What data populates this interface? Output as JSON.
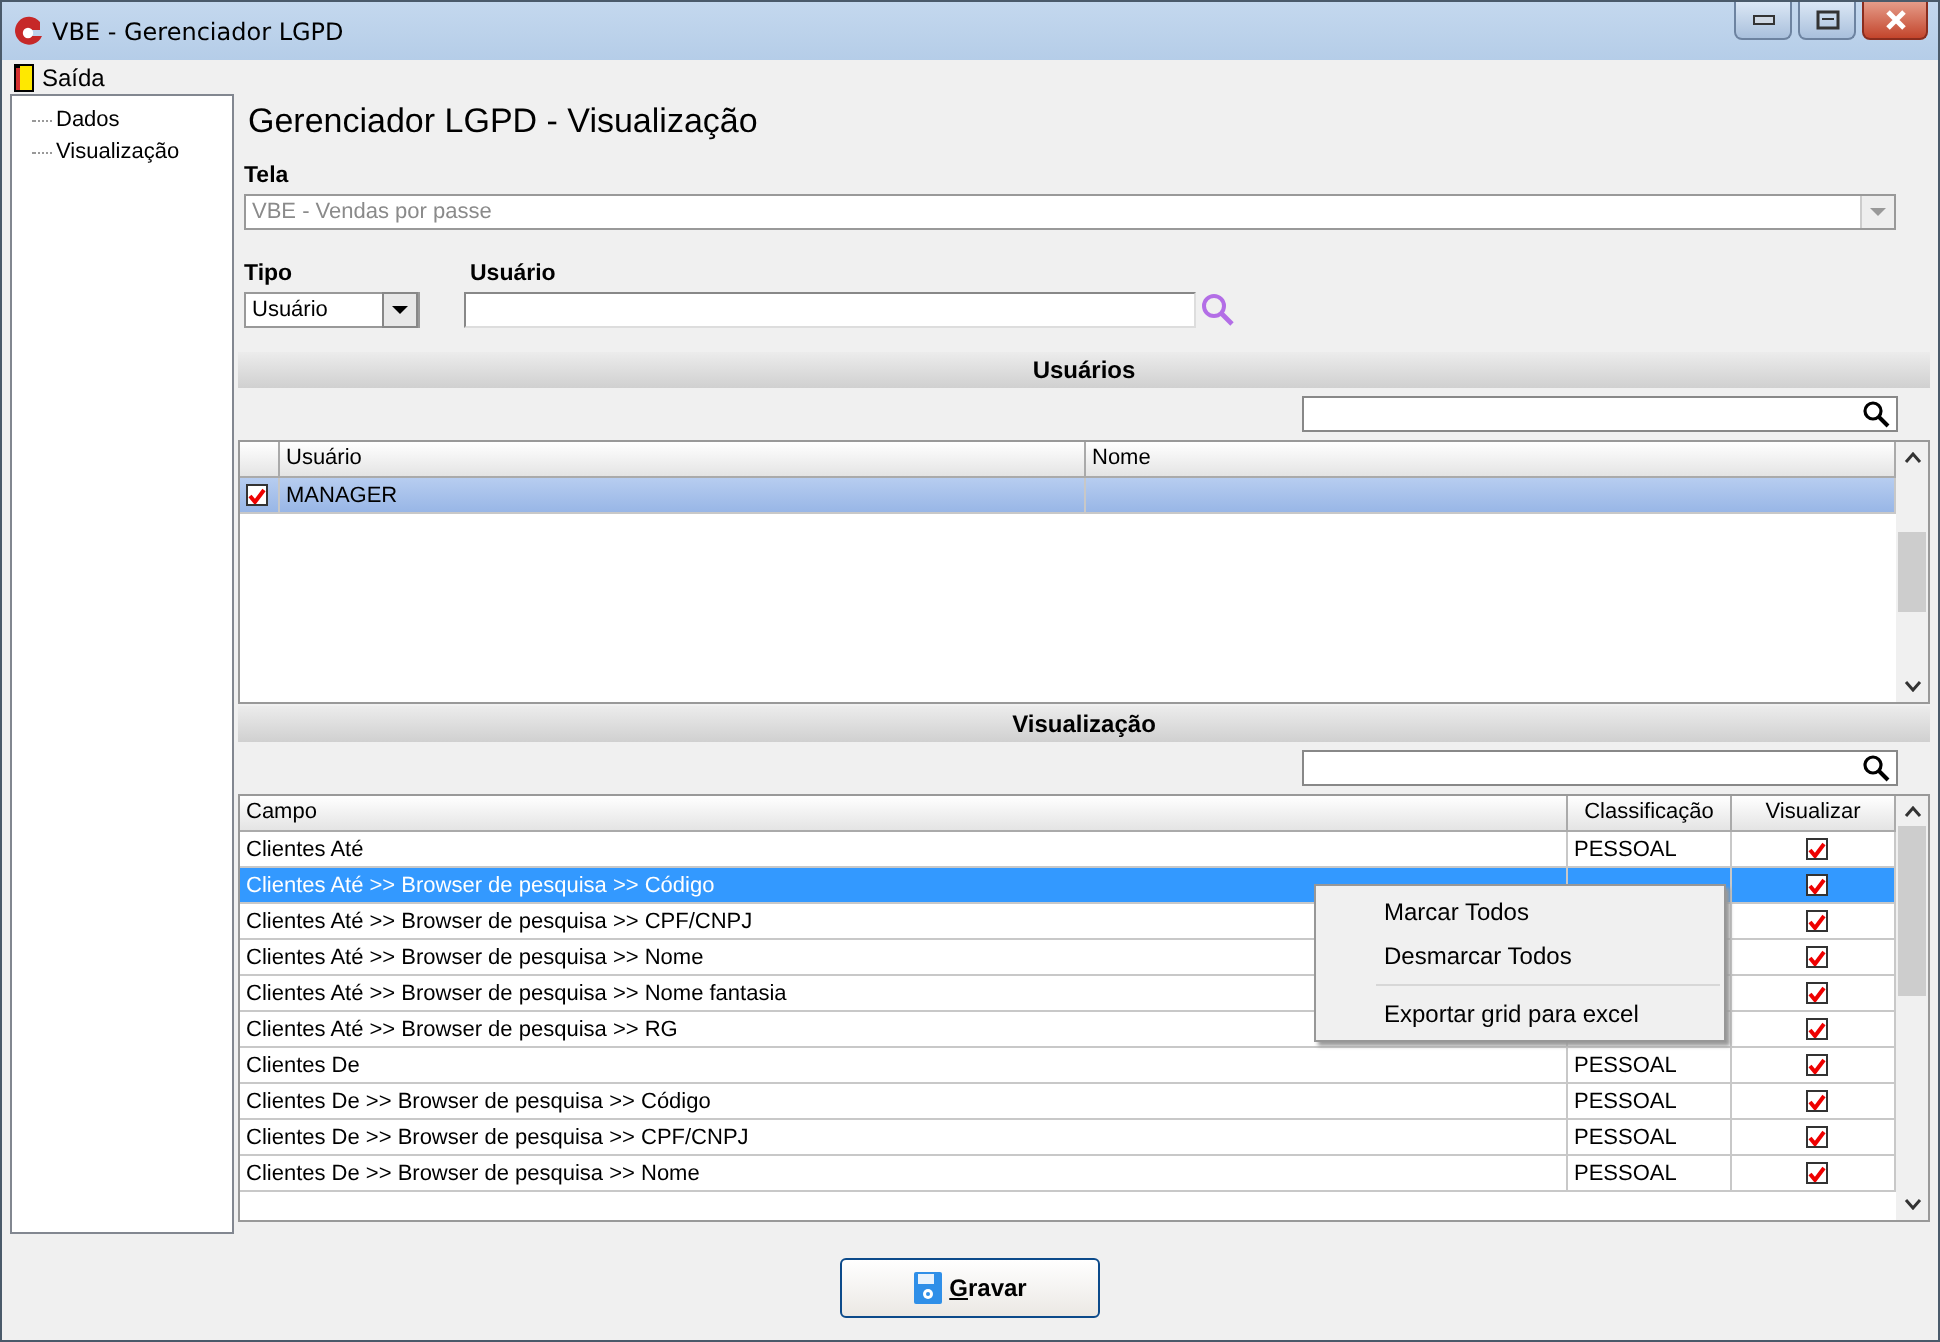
{
  "window": {
    "title": "VBE - Gerenciador LGPD"
  },
  "menu": [
    {
      "label": "Saída"
    }
  ],
  "sidebar": {
    "items": [
      {
        "label": "Dados"
      },
      {
        "label": "Visualização"
      }
    ]
  },
  "page_title": "Gerenciador LGPD - Visualização",
  "tela": {
    "label": "Tela",
    "value": "VBE - Vendas por passe",
    "disabled": true
  },
  "tipo": {
    "label": "Tipo",
    "value": "Usuário"
  },
  "usuario": {
    "label": "Usuário"
  },
  "users_section": {
    "title": "Usuários",
    "columns": [
      "Usuário",
      "Nome"
    ],
    "rows": [
      {
        "usuario": "MANAGER",
        "checked": true,
        "selected": true
      }
    ]
  },
  "view_section": {
    "title": "Visualização",
    "columns": [
      "Campo",
      "Classificação",
      "Visualizar"
    ],
    "rows": [
      {
        "campo": "Clientes Até",
        "classificacao": "PESSOAL",
        "visualizar": true,
        "selected": false
      },
      {
        "campo": "Clientes Até >> Browser de pesquisa >> Código",
        "visualizar": true,
        "selected": true
      },
      {
        "campo": "Clientes Até >> Browser de pesquisa >> CPF/CNPJ",
        "visualizar": true,
        "selected": false
      },
      {
        "campo": "Clientes Até >> Browser de pesquisa >> Nome",
        "visualizar": true,
        "selected": false
      },
      {
        "campo": "Clientes Até >> Browser de pesquisa >> Nome fantasia",
        "visualizar": true,
        "selected": false
      },
      {
        "campo": "Clientes Até >> Browser de pesquisa >> RG",
        "visualizar": true,
        "selected": false
      },
      {
        "campo": "Clientes De",
        "classificacao": "PESSOAL",
        "visualizar": true,
        "selected": false
      },
      {
        "campo": "Clientes De >> Browser de pesquisa >> Código",
        "classificacao": "PESSOAL",
        "visualizar": true,
        "selected": false
      },
      {
        "campo": "Clientes De >> Browser de pesquisa >> CPF/CNPJ",
        "classificacao": "PESSOAL",
        "visualizar": true,
        "selected": false
      },
      {
        "campo": "Clientes De >> Browser de pesquisa >> Nome",
        "classificacao": "PESSOAL",
        "visualizar": true,
        "selected": false
      }
    ]
  },
  "context_menu": {
    "items": [
      {
        "kind": "item",
        "label": "Marcar Todos"
      },
      {
        "kind": "item",
        "label": "Desmarcar Todos"
      },
      {
        "kind": "separator"
      },
      {
        "kind": "item",
        "label": "Exportar grid para excel"
      }
    ]
  },
  "save_button": {
    "label": "Gravar"
  }
}
